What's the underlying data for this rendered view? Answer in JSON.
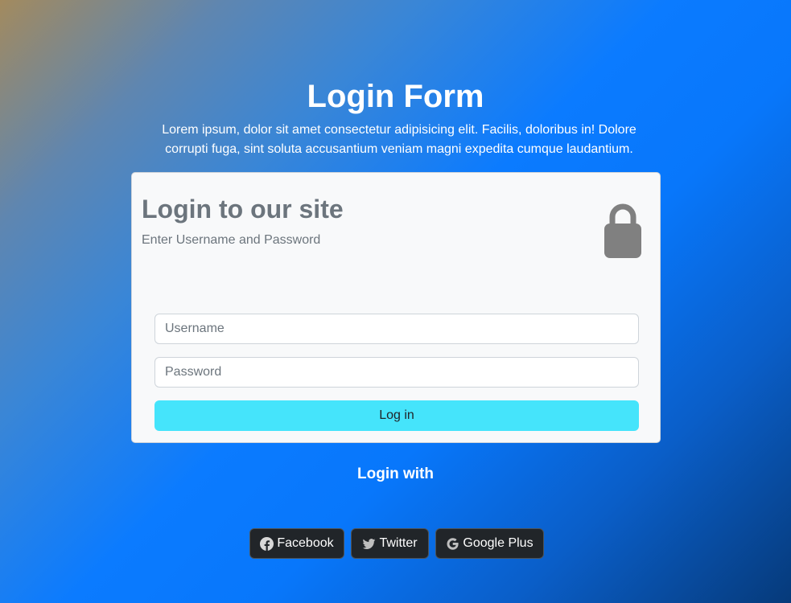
{
  "header": {
    "title": "Login Form",
    "description": "Lorem ipsum, dolor sit amet consectetur adipisicing elit. Facilis, doloribus in! Dolore corrupti fuga, sint soluta accusantium veniam magni expedita cumque laudantium."
  },
  "card": {
    "heading": "Login to our site",
    "subheading": "Enter Username and Password",
    "icon": "lock-icon",
    "username_placeholder": "Username",
    "username_value": "",
    "password_placeholder": "Password",
    "password_value": "",
    "login_label": "Log in"
  },
  "social": {
    "heading": "Login with",
    "buttons": [
      {
        "label": "Facebook",
        "icon": "facebook-icon"
      },
      {
        "label": "Twitter",
        "icon": "twitter-icon"
      },
      {
        "label": "Google Plus",
        "icon": "google-icon"
      }
    ]
  },
  "colors": {
    "card_background": "#f8f9fa",
    "login_button": "#45e4fb",
    "social_button": "#212529",
    "muted_text": "#6c757d",
    "lock_icon": "#808080"
  }
}
